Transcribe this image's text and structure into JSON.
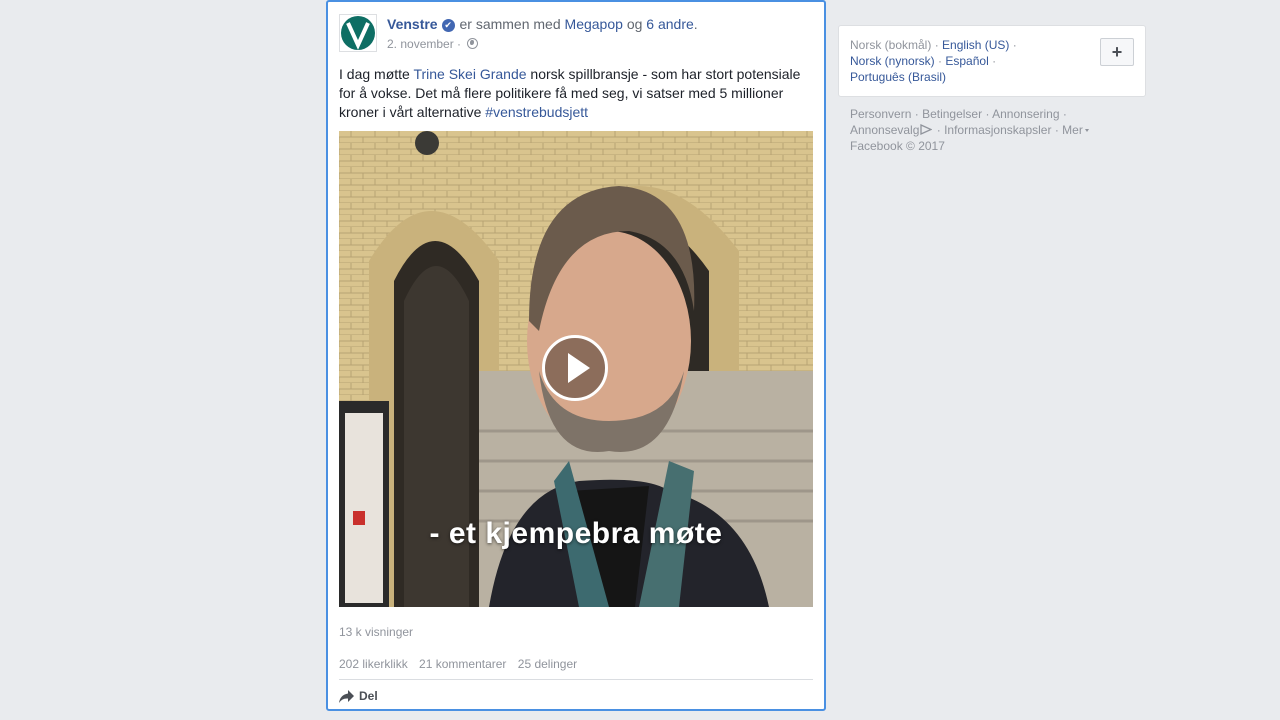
{
  "post": {
    "page_name": "Venstre",
    "with_text": "er sammen med",
    "with_page": "Megapop",
    "and_text": "og",
    "others_link": "6 andre",
    "period": ".",
    "date": "2. november",
    "dot": "·",
    "text_before": "I dag møtte ",
    "mention": "Trine Skei Grande",
    "text_after": " norsk spillbransje - som har stort potensiale for å vokse. Det må flere politikere få med seg, vi satser med 5 millioner kroner i vårt alternative ",
    "hashtag": "#venstrebudsjett",
    "video_caption": "- et kjempebra møte",
    "views": "13 k visninger",
    "likes": "202 likerklikk",
    "comments": "21 kommentarer",
    "shares": "25 delinger",
    "share_label": "Del"
  },
  "languages": {
    "current": "Norsk (bokmål)",
    "sep": "·",
    "options": [
      "English (US)",
      "Norsk (nynorsk)",
      "Español",
      "Português (Brasil)"
    ],
    "add_symbol": "+"
  },
  "footer": {
    "links": [
      "Personvern",
      "Betingelser",
      "Annonsering",
      "Annonsevalg",
      "Informasjonskapsler",
      "Mer"
    ],
    "copyright": "Facebook © 2017"
  },
  "colors": {
    "accent": "#365899",
    "logo_green": "#0e6e64",
    "focus_border": "#4a90e2"
  }
}
